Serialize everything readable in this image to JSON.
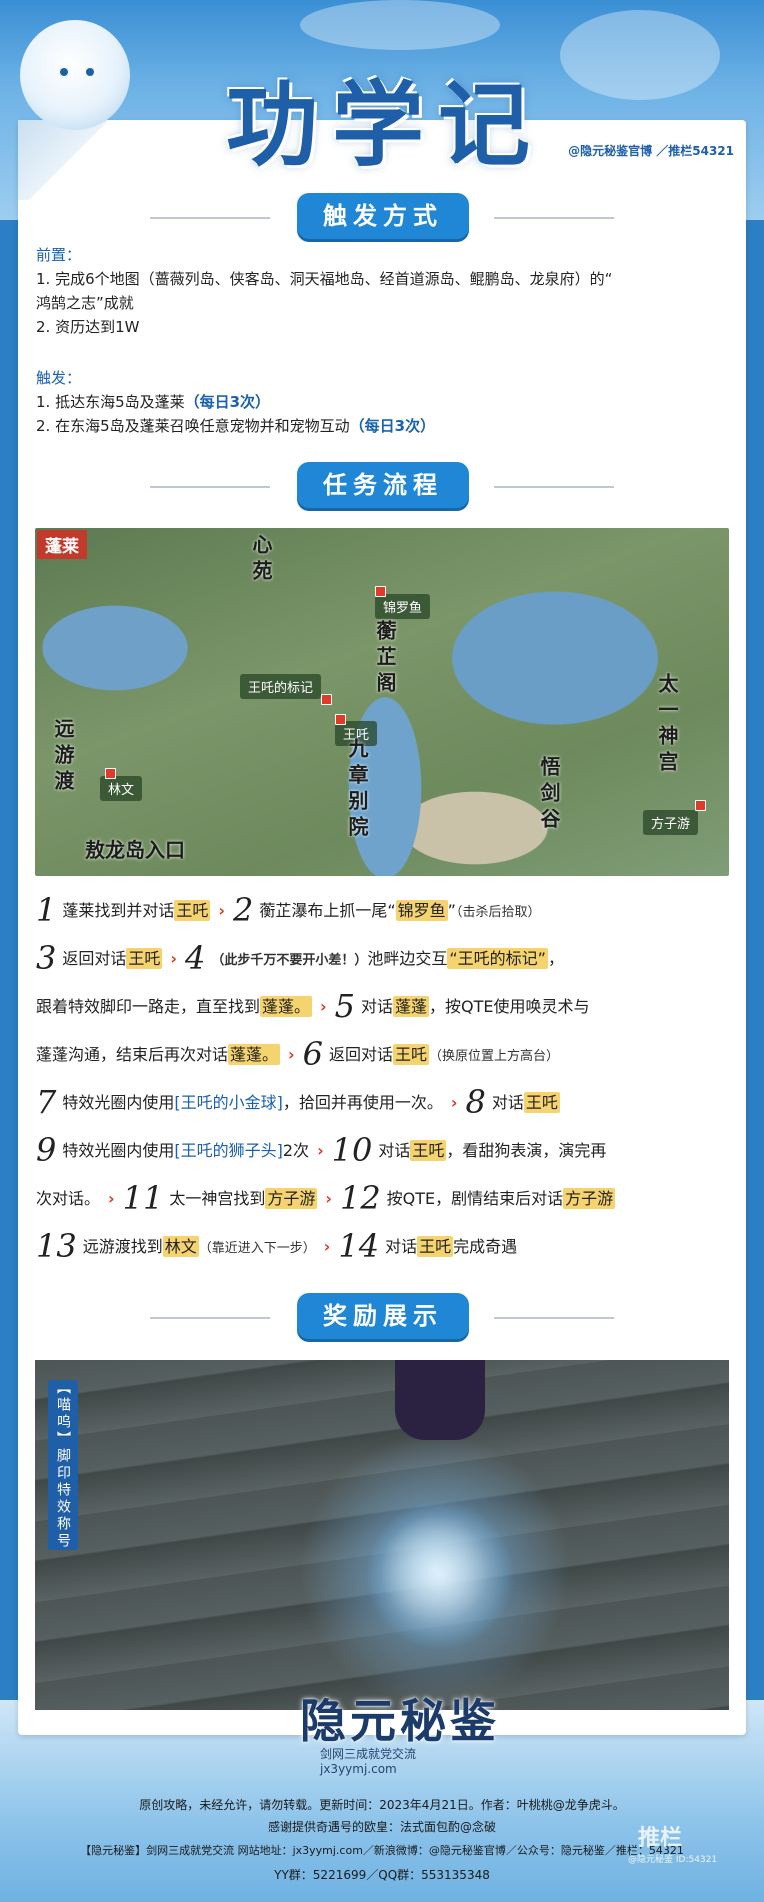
{
  "header": {
    "title": "功学记",
    "credit": "@隐元秘鉴官博 ／推栏54321"
  },
  "trigger": {
    "heading": "触发方式",
    "pre_label": "前置：",
    "pre_1a": "1. 完成6个地图（蔷薇列岛、侠客岛、洞天福地岛、经首道源岛、鲲鹏岛、龙泉府）的“",
    "pre_1b": "鸿鹄之志”成就",
    "pre_2": "2. 资历达到1W",
    "trig_label": "触发：",
    "trig_1": "1. 抵达东海5岛及蓬莱",
    "trig_1_note": "（每日3次）",
    "trig_2": "2. 在东海5岛及蓬莱召唤任意宠物并和宠物互动",
    "trig_2_note": "（每日3次）"
  },
  "process": {
    "heading": "任务流程",
    "map_tag": "蓬莱",
    "map_labels": {
      "jinluoyu": "锦罗鱼",
      "wangtun_mark": "王吒的标记",
      "wangtun": "王吒",
      "linwen": "林文",
      "fangziyou": "方子游"
    },
    "map_places": {
      "yuanyoudu": "远游渡",
      "aolong": "敖龙岛入口",
      "jiuzhang": "九章别院",
      "taiyi": "太一神宫",
      "wujian": "悟剑谷",
      "hengzhi": "蘅芷阁",
      "xin": "心苑"
    }
  },
  "steps": {
    "s1_num": "1",
    "s1a": "蓬莱找到并对话",
    "s1_hl": "王吒",
    "s2_num": "2",
    "s2a": "蘅芷瀑布上抓一尾“",
    "s2_hl": "锦罗鱼",
    "s2b": "”",
    "s2_note": "（击杀后拾取）",
    "s3_num": "3",
    "s3a": "返回对话",
    "s3_hl": "王吒",
    "s4_num": "4",
    "s4_warn": "（此步千万不要开小差！）",
    "s4a": "池畔边交互",
    "s4_hl": "“王吒的标记”",
    "s4b": "，",
    "s4c": "跟着特效脚印一路走，直至找到",
    "s4_hl2": "蓬蓬。",
    "s5_num": "5",
    "s5a": "对话",
    "s5_hl": "蓬蓬",
    "s5b": "，按QTE使用唤灵术与",
    "s5c": "蓬蓬沟通，结束后再次对话",
    "s5_hl2": "蓬蓬。",
    "s6_num": "6",
    "s6a": "返回对话",
    "s6_hl": "王吒",
    "s6_note": "（换原位置上方高台）",
    "s7_num": "7",
    "s7a": "特效光圈内使用",
    "s7_item": "[王吒的小金球]",
    "s7b": "，拾回并再使用一次。",
    "s8_num": "8",
    "s8a": "对话",
    "s8_hl": "王吒",
    "s9_num": "9",
    "s9a": "特效光圈内使用",
    "s9_item": "[王吒的狮子头]",
    "s9b": "2次",
    "s10_num": "10",
    "s10a": "对话",
    "s10_hl": "王吒",
    "s10b": "，看甜狗表演，演完再",
    "s10c": "次对话。",
    "s11_num": "11",
    "s11a": "太一神宫找到",
    "s11_hl": "方子游",
    "s12_num": "12",
    "s12a": "按QTE，剧情结束后对话",
    "s12_hl": "方子游",
    "s13_num": "13",
    "s13a": "远游渡找到",
    "s13_hl": "林文",
    "s13_note": "（靠近进入下一步）",
    "s14_num": "14",
    "s14a": "对话",
    "s14_hl": "王吒",
    "s14b": "完成奇遇",
    "arrow": "›"
  },
  "reward": {
    "heading": "奖励展示",
    "tag": "【喵呜】脚印特效称号"
  },
  "logo": {
    "main": "隐元秘鉴",
    "sub": "剑网三成就党交流",
    "url": "jx3yymj.com"
  },
  "footer": {
    "line1": "原创攻略，未经允许，请勿转载。更新时间：2023年4月21日。作者：叶桃桃@龙争虎斗。",
    "line2": "感谢提供奇遇号的欧皇：法式面包酌@念破",
    "line3": "【隐元秘鉴】剑网三成就党交流  网站地址：jx3yymj.com／新浪微博：@隐元秘鉴官博／公众号：隐元秘鉴／推栏：54321",
    "line4": "YY群：5221699／QQ群：553135348",
    "watermark": "推栏",
    "watermark_id": "@隐元秘鉴 ID:54321"
  },
  "colors": {
    "accent": "#1f87d6",
    "title": "#1f5fa8",
    "highlight": "#f5d36e",
    "warn": "#d93a2a"
  }
}
